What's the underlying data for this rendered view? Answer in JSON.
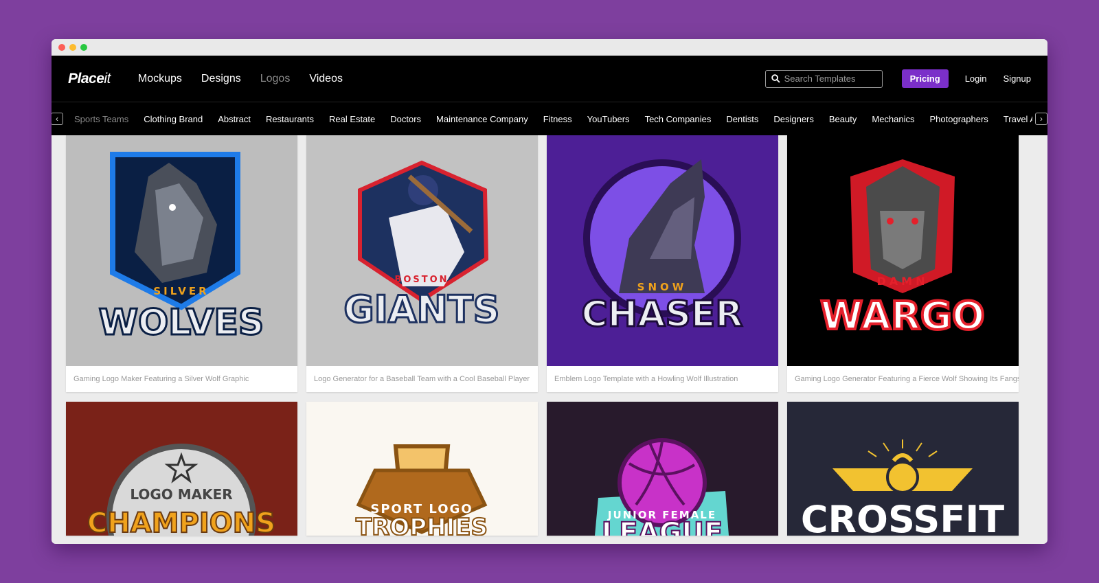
{
  "nav": {
    "brand_bold": "Place",
    "brand_rest": "it",
    "items": [
      "Mockups",
      "Designs",
      "Logos",
      "Videos"
    ],
    "search_placeholder": "Search Templates",
    "pricing": "Pricing",
    "login": "Login",
    "signup": "Signup"
  },
  "categories": [
    "Sports Teams",
    "Clothing Brand",
    "Abstract",
    "Restaurants",
    "Real Estate",
    "Doctors",
    "Maintenance Company",
    "Fitness",
    "YouTubers",
    "Tech Companies",
    "Dentists",
    "Designers",
    "Beauty",
    "Mechanics",
    "Photographers",
    "Travel Agencies"
  ],
  "cards": [
    {
      "caption": "Gaming Logo Maker Featuring a Silver Wolf Graphic",
      "bg": "#bdbdbd",
      "small": "SILVER",
      "big": "WOLVES",
      "accent": "#1e7be8"
    },
    {
      "caption": "Logo Generator for a Baseball Team with a Cool Baseball Player",
      "bg": "#c2c2c2",
      "small": "BOSTON",
      "big": "GIANTS",
      "accent": "#d8222f"
    },
    {
      "caption": "Emblem Logo Template with a Howling Wolf Illustration",
      "bg": "#4d1f96",
      "small": "SNOW",
      "big": "CHASER",
      "accent": "#8c5df2"
    },
    {
      "caption": "Gaming Logo Generator Featuring a Fierce Wolf Showing Its Fangs",
      "bg": "#000000",
      "small": "DAMN",
      "big": "WARGO",
      "accent": "#e4202b"
    }
  ],
  "cards_row2": [
    {
      "bg": "#7a2218",
      "small": "LOGO MAKER",
      "big": "CHAMPIONS"
    },
    {
      "bg": "#faf7f1",
      "small": "SPORT LOGO",
      "big": "TROPHIES"
    },
    {
      "bg": "#281a2c",
      "small": "JUNIOR FEMALE",
      "big": "LEAGUE"
    },
    {
      "bg": "#262838",
      "small": "",
      "big": "CROSSFIT"
    }
  ]
}
